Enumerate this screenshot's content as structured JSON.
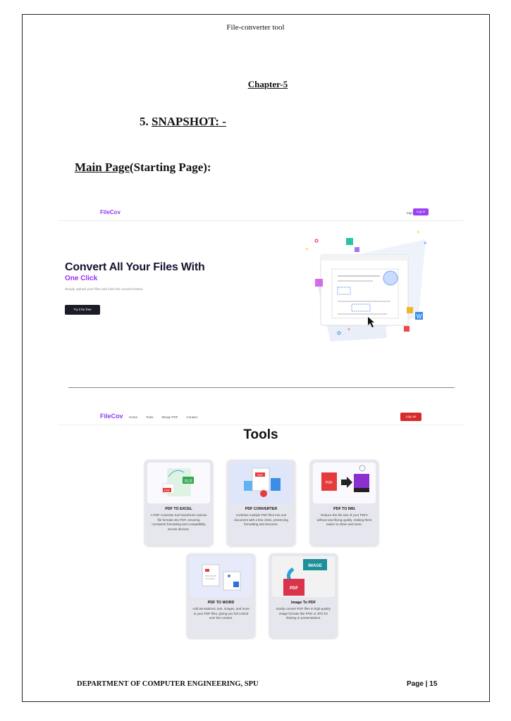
{
  "page": {
    "header": "File-converter tool",
    "chapter": "Chapter-5",
    "section_number": "5.",
    "section_title": "SNAPSHOT: -",
    "subsection_underlined": "Main Page",
    "subsection_rest": "(Starting Page):",
    "footer_left": "DEPARTMENT OF COMPUTER ENGINEERING, SPU",
    "footer_right": "Page | 15"
  },
  "screenshot1": {
    "logo": "FileCov",
    "signup": "Sign up",
    "login": "Log in",
    "hero_title": "Convert All Your Files With",
    "hero_subtitle": "One Click",
    "hero_desc": "Simply upload your files and click the convert button.",
    "cta": "Try it for free"
  },
  "screenshot2": {
    "logo": "FileCov",
    "nav": [
      "Home",
      "Tools",
      "Merge PDF",
      "Contact"
    ],
    "logout": "Log out",
    "title": "Tools",
    "cards": [
      {
        "title": "PDF TO EXCEL",
        "desc": "A PDF converter tool transforms various file formats into PDF, ensuring consistent formatting and compatibility across devices."
      },
      {
        "title": "PDF CONVERTER",
        "desc": "Combine multiple PDF files into one document with a few clicks, preserving formatting and structure."
      },
      {
        "title": "PDF TO IMG",
        "desc": "Reduce the file size of your PDFs without sacrificing quality, making them easier to share and store."
      },
      {
        "title": "PDF TO WORD",
        "desc": "Add annotations, text, images, and more to your PDF files, giving you full control over the content."
      },
      {
        "title": "Image To PDF",
        "desc": "Easily convert PDF files to high-quality image formats like PNG or JPG for sharing or presentations."
      }
    ],
    "image_labels": {
      "pdf": "PDF",
      "xls": "XLS",
      "image": "IMAGE",
      "word": "W"
    }
  },
  "colors": {
    "brand": "#8b3df0",
    "logout": "#d62b2b",
    "dark_button": "#1c1c28"
  }
}
